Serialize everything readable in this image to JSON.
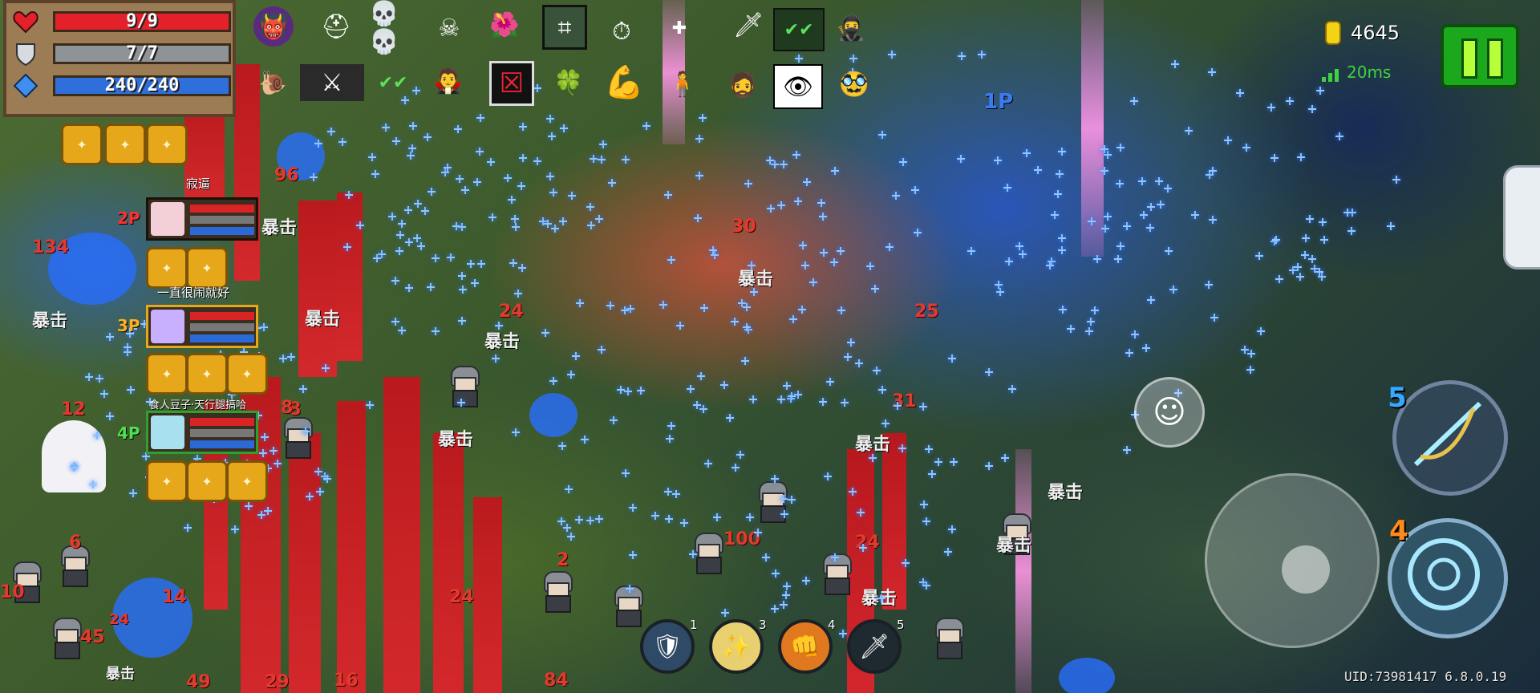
{
  "stats": {
    "hp": {
      "text": "9/9",
      "fraction": 1.0,
      "color": "#e4212b"
    },
    "armor": {
      "text": "7/7",
      "fraction": 1.0,
      "color": "#8e9398"
    },
    "energy": {
      "text": "240/240",
      "fraction": 1.0,
      "color": "#2e6fdc"
    }
  },
  "currency": {
    "coins": "4645",
    "ping": "20ms"
  },
  "players": [
    {
      "tag": "2P",
      "name": "寂逼"
    },
    {
      "tag": "3P",
      "name": "一直很闹就好"
    },
    {
      "tag": "4P",
      "name": "食人豆子·天行腿搞哈"
    }
  ],
  "floating": {
    "p1": "1P"
  },
  "crit_label": "暴击",
  "damage_numbers": [
    "134",
    "96",
    "24",
    "12",
    "8",
    "6",
    "14",
    "24",
    "45",
    "10",
    "49",
    "29",
    "16",
    "84",
    "24",
    "24",
    "30",
    "25",
    "31",
    "2",
    "100",
    "8"
  ],
  "weapons": [
    {
      "slot": "5",
      "color": "#35a8ff"
    },
    {
      "slot": "4",
      "color": "#ff8a1a"
    }
  ],
  "skills": [
    {
      "num": "1"
    },
    {
      "num": "3"
    },
    {
      "num": "4"
    },
    {
      "num": "5"
    }
  ],
  "uid": "UID:73981417 6.8.0.19",
  "icons": {
    "hp": "heart-icon",
    "armor": "shield-icon",
    "energy": "energy-crystal-icon",
    "coin": "coin-icon",
    "signal": "signal-icon",
    "pause": "pause-icon",
    "emote": "smiley-icon",
    "chat": "penguin-icon"
  }
}
